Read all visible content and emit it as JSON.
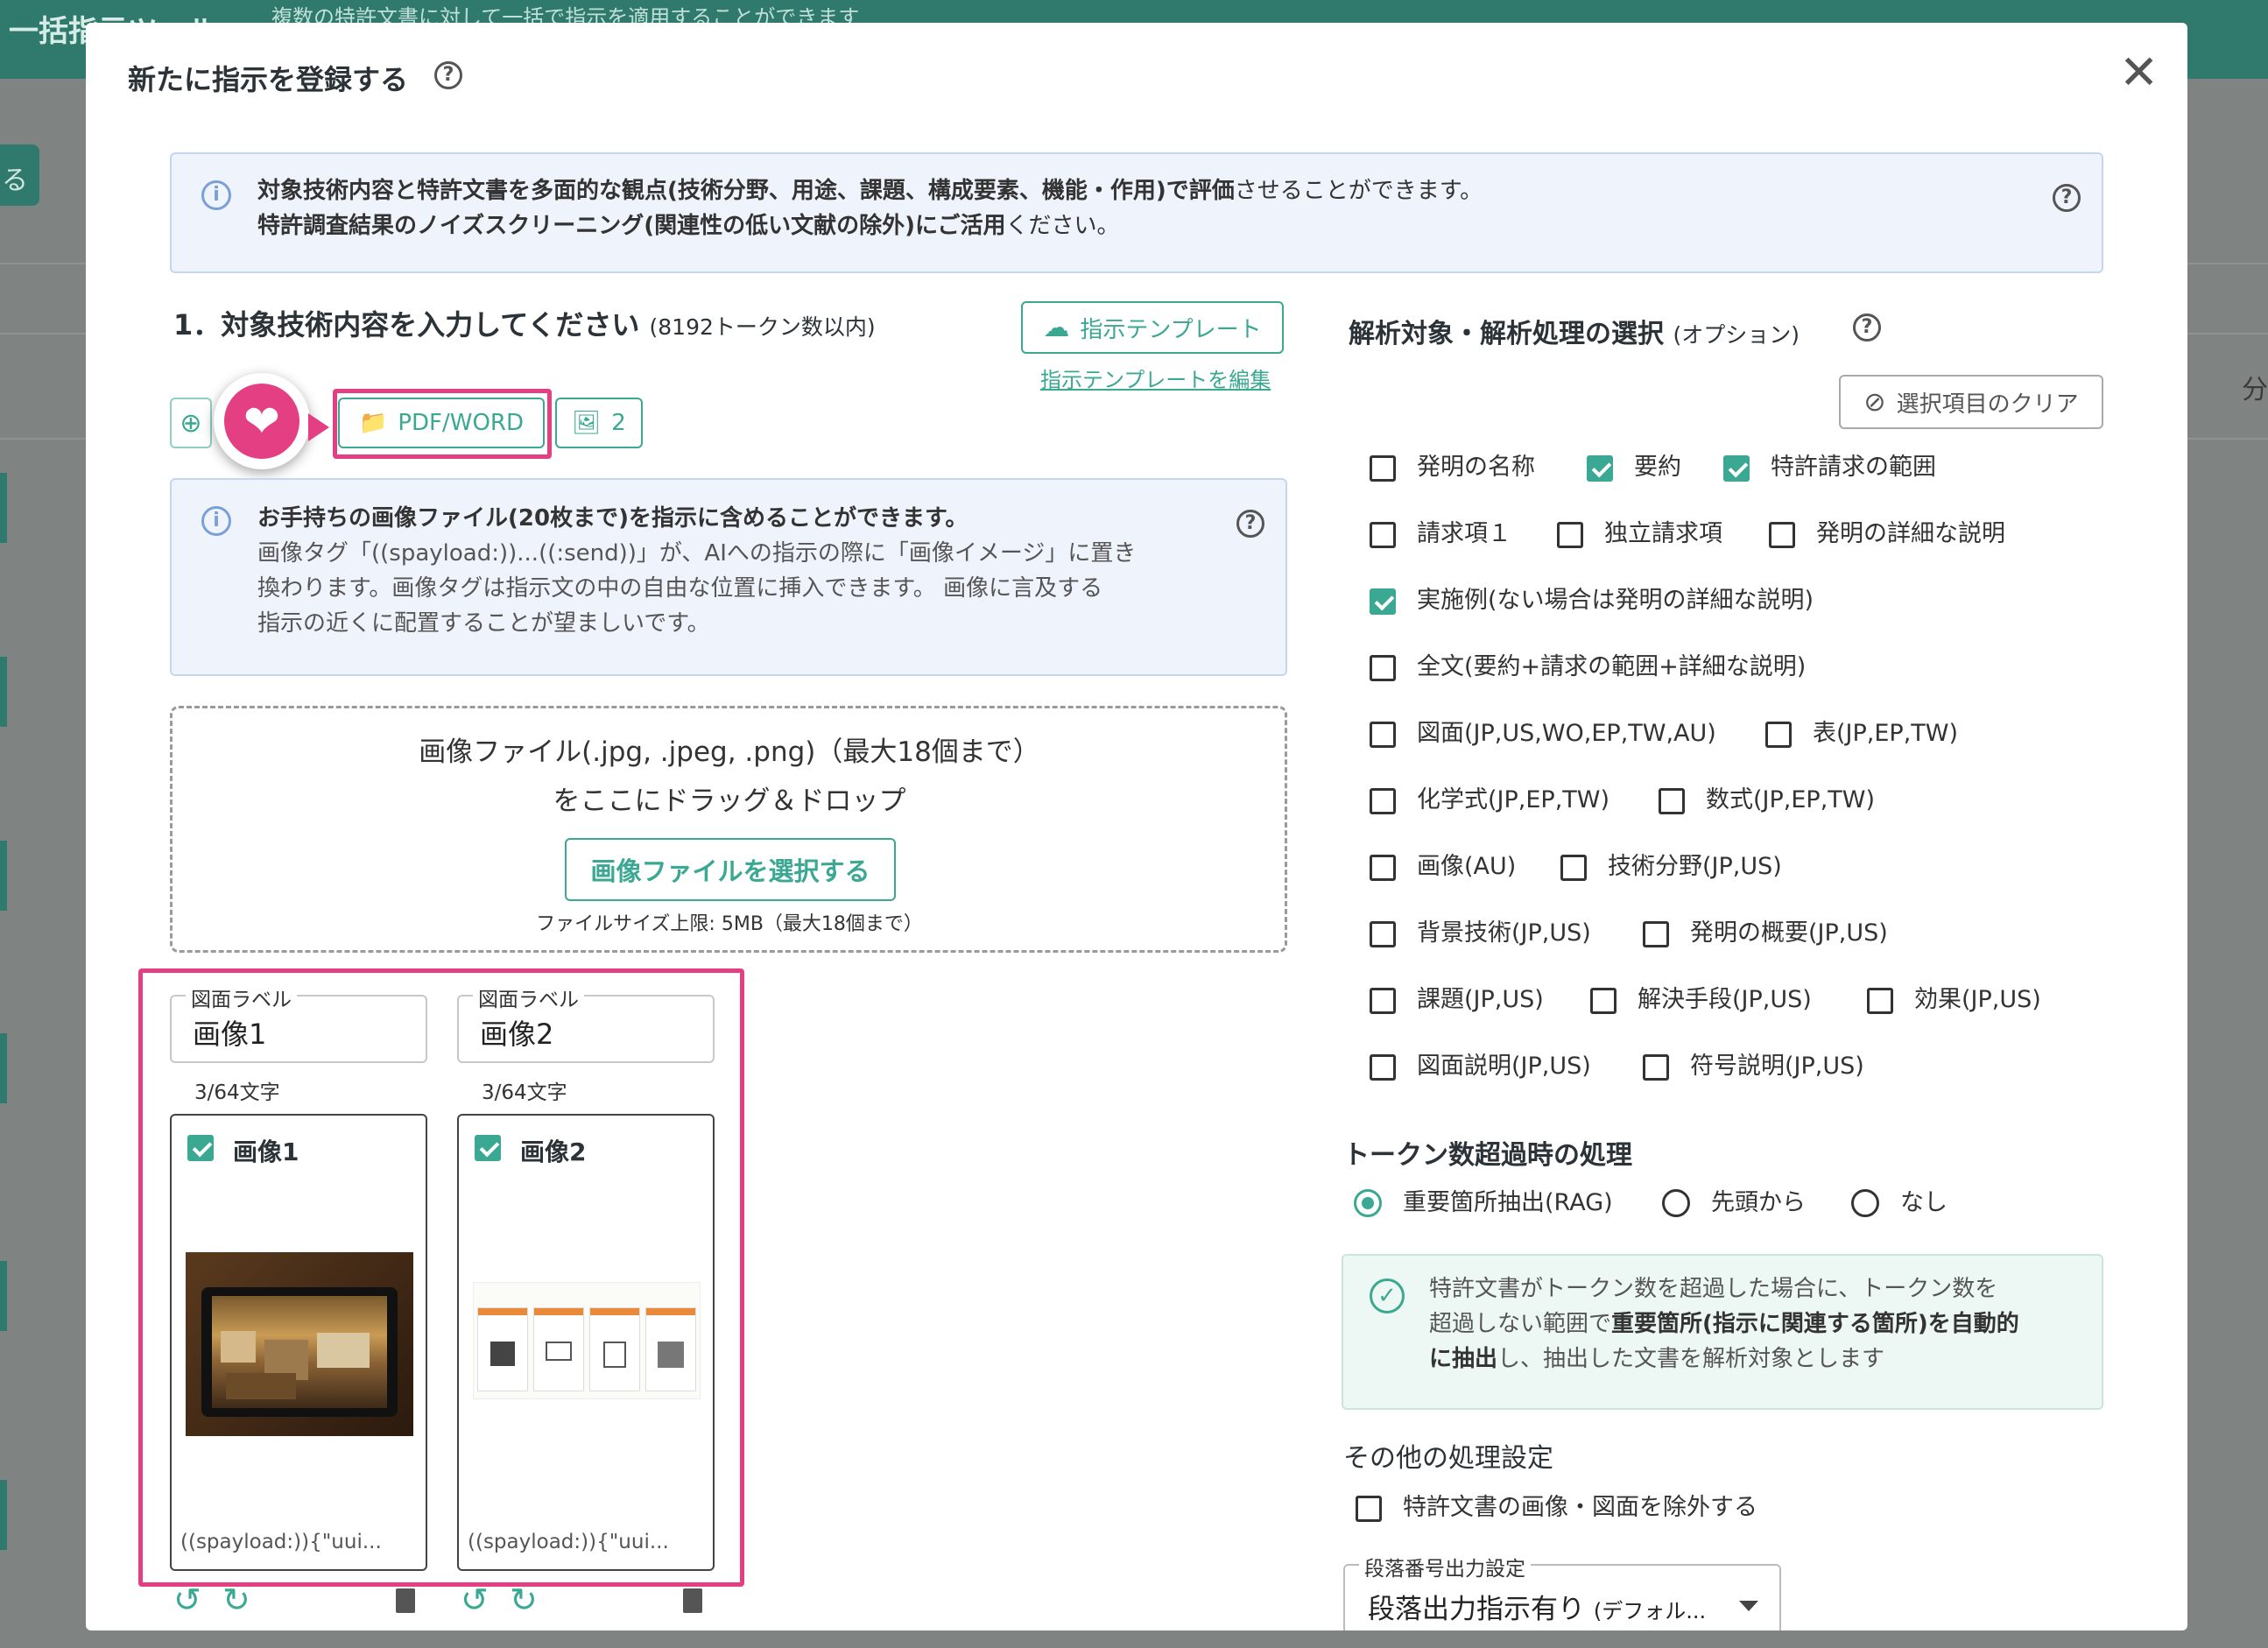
{
  "background": {
    "app_title": "一括指示ツール",
    "hint": "複数の特許文書に対して一括で指示を適用することができます",
    "side_button_label": "る",
    "right_edge_glyph": "分"
  },
  "modal": {
    "title": "新たに指示を登録する",
    "close_label": "✕",
    "info": {
      "line1_bold": "対象技術内容と特許文書を多面的な観点(技術分野、用途、課題、構成要素、機能・作用)で評価",
      "line1_rest": "させることができます。",
      "line2_bold": "特許調査結果のノイズスクリーニング(関連性の低い文献の除外)にご活用",
      "line2_rest": "ください。"
    }
  },
  "left": {
    "section_title": "1．対象技術内容を入力してください",
    "section_note": "(8192トークン数以内)",
    "template_button": "指示テンプレート",
    "template_edit_link": "指示テンプレートを編集",
    "toolbar": {
      "pdf_word_label": "PDF/WORD",
      "image_count": "2"
    },
    "image_info": {
      "title": "お手持ちの画像ファイル(20枚まで)を指示に含めることができます。",
      "line1": "画像タグ「((spayload:))...((:send))」が、AIへの指示の際に「画像イメージ」に置き",
      "line2": "換わります。画像タグは指示文の中の自由な位置に挿入できます。 画像に言及する",
      "line3": "指示の近くに配置することが望ましいです。"
    },
    "dropzone": {
      "line1": "画像ファイル(.jpg, .jpeg, .png)（最大18個まで）",
      "line2": "をここにドラッグ＆ドロップ",
      "select_button": "画像ファイルを選択する",
      "size_limit": "ファイルサイズ上限: 5MB（最大18個まで）"
    },
    "images": [
      {
        "field_label": "図面ラベル",
        "value": "画像1",
        "counter": "3/64文字",
        "card_title": "画像1",
        "checked": true,
        "tag": "((spayload:)){\"uui..."
      },
      {
        "field_label": "図面ラベル",
        "value": "画像2",
        "counter": "3/64文字",
        "card_title": "画像2",
        "checked": true,
        "tag": "((spayload:)){\"uui..."
      }
    ]
  },
  "right": {
    "section_title": "解析対象・解析処理の選択",
    "section_note": "(オプション)",
    "clear_button": "選択項目のクリア",
    "options": [
      {
        "label": "発明の名称",
        "checked": false
      },
      {
        "label": "要約",
        "checked": true
      },
      {
        "label": "特許請求の範囲",
        "checked": true
      },
      {
        "label": "請求項１",
        "checked": false
      },
      {
        "label": "独立請求項",
        "checked": false
      },
      {
        "label": "発明の詳細な説明",
        "checked": false
      },
      {
        "label": "実施例(ない場合は発明の詳細な説明)",
        "checked": true
      },
      {
        "label": "全文(要約+請求の範囲+詳細な説明)",
        "checked": false
      },
      {
        "label": "図面(JP,US,WO,EP,TW,AU)",
        "checked": false
      },
      {
        "label": "表(JP,EP,TW)",
        "checked": false
      },
      {
        "label": "化学式(JP,EP,TW)",
        "checked": false
      },
      {
        "label": "数式(JP,EP,TW)",
        "checked": false
      },
      {
        "label": "画像(AU)",
        "checked": false
      },
      {
        "label": "技術分野(JP,US)",
        "checked": false
      },
      {
        "label": "背景技術(JP,US)",
        "checked": false
      },
      {
        "label": "発明の概要(JP,US)",
        "checked": false
      },
      {
        "label": "課題(JP,US)",
        "checked": false
      },
      {
        "label": "解決手段(JP,US)",
        "checked": false
      },
      {
        "label": "効果(JP,US)",
        "checked": false
      },
      {
        "label": "図面説明(JP,US)",
        "checked": false
      },
      {
        "label": "符号説明(JP,US)",
        "checked": false
      }
    ],
    "token_section_title": "トークン数超過時の処理",
    "token_options": [
      {
        "label": "重要箇所抽出(RAG)",
        "selected": true
      },
      {
        "label": "先頭から",
        "selected": false
      },
      {
        "label": "なし",
        "selected": false
      }
    ],
    "rag_info": {
      "line1": "特許文書がトークン数を超過した場合に、トークン数を",
      "line2_plain": "超過しない範囲で",
      "line2_bold": "重要箇所(指示に関連する箇所)を自動的",
      "line3_bold": "に抽出",
      "line3_plain": "し、抽出した文書を解析対象とします"
    },
    "other_title": "その他の処理設定",
    "exclude_images_label": "特許文書の画像・図面を除外する",
    "exclude_images_checked": false,
    "paragraph_select": {
      "label": "段落番号出力設定",
      "value": "段落出力指示有り",
      "value_note": "(デフォル..."
    }
  },
  "colors": {
    "accent": "#3aa892",
    "highlight": "#e43f83",
    "info_bg": "#eef3fc",
    "success_bg": "#edf8f4"
  }
}
